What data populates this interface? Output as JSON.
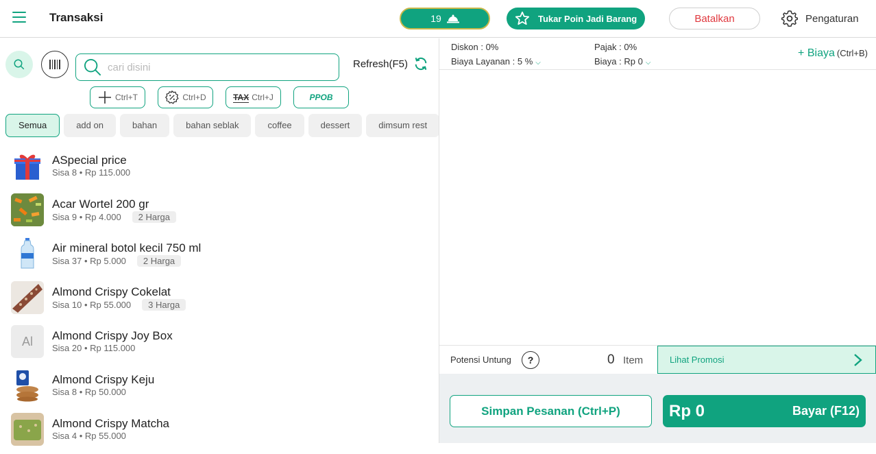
{
  "header": {
    "title": "Transaksi",
    "table_count": "19",
    "tukar_label": "Tukar Poin Jadi Barang",
    "batal_label": "Batalkan",
    "settings_label": "Pengaturan"
  },
  "toolbar": {
    "search_placeholder": "cari disini",
    "refresh_label": "Refresh(F5)",
    "shortcuts": [
      {
        "icon": "plus-icon",
        "label": "Ctrl+T"
      },
      {
        "icon": "discount-badge-icon",
        "label": "Ctrl+D"
      },
      {
        "icon": "tax-icon",
        "label": "Ctrl+J",
        "icon_text": "TAX"
      },
      {
        "icon": "ppob-logo",
        "label": "PPOB"
      }
    ]
  },
  "categories": [
    "Semua",
    "add on",
    "bahan",
    "bahan seblak",
    "coffee",
    "dessert",
    "dimsum rest"
  ],
  "products": [
    {
      "name": "ASpecial price",
      "meta": "Sisa 8 • Rp 115.000",
      "harga": ""
    },
    {
      "name": "Acar Wortel 200 gr",
      "meta": "Sisa 9 • Rp 4.000",
      "harga": "2 Harga"
    },
    {
      "name": "Air mineral botol kecil 750 ml",
      "meta": "Sisa 37 • Rp 5.000",
      "harga": "2 Harga"
    },
    {
      "name": "Almond Crispy Cokelat",
      "meta": "Sisa 10 • Rp 55.000",
      "harga": "3 Harga"
    },
    {
      "name": "Almond Crispy Joy Box",
      "meta": "Sisa 20 • Rp 115.000",
      "harga": "",
      "initials": "Al"
    },
    {
      "name": "Almond Crispy Keju",
      "meta": "Sisa 8 • Rp 50.000",
      "harga": ""
    },
    {
      "name": "Almond Crispy Matcha",
      "meta": "Sisa 4 • Rp 55.000",
      "harga": ""
    }
  ],
  "order": {
    "diskon": "Diskon : 0%",
    "pajak": "Pajak : 0%",
    "biaya_layanan": "Biaya Layanan : 5 %",
    "biaya": "Biaya : Rp 0",
    "add_biaya": "+ Biaya",
    "add_biaya_shortcut": "(Ctrl+B)",
    "potensi_label": "Potensi Untung",
    "item_count": "0",
    "item_label": "Item",
    "promo_label": "Lihat Promosi",
    "simpan_label": "Simpan Pesanan (Ctrl+P)",
    "total": "Rp 0",
    "bayar_label": "Bayar (F12)"
  },
  "colors": {
    "accent": "#10a37f",
    "danger": "#e0383e",
    "accent_light": "#d9f5e9"
  }
}
